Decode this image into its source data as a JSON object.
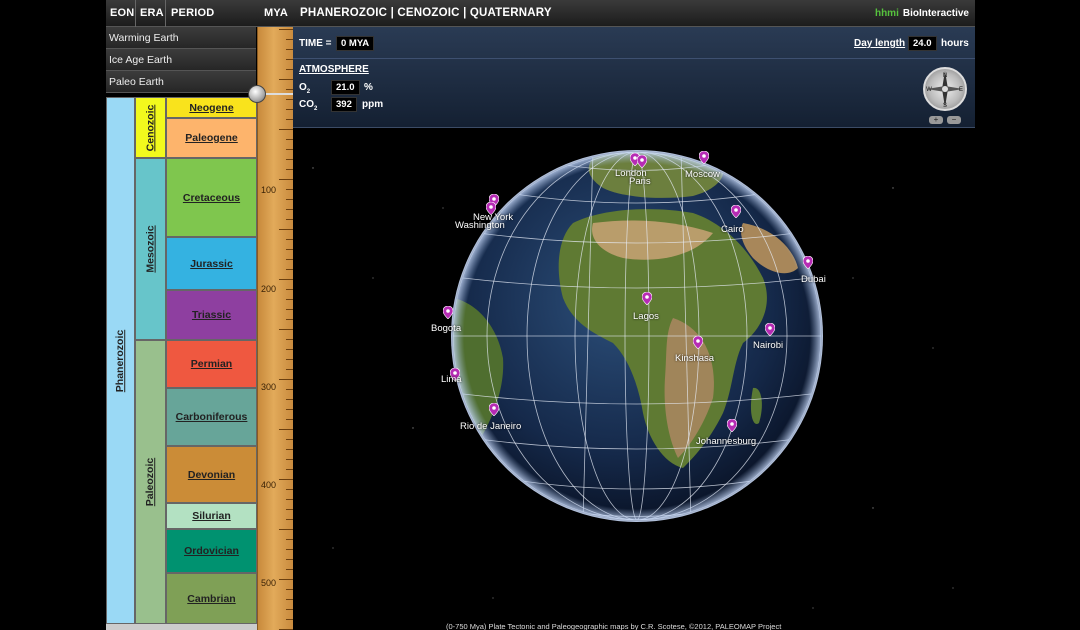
{
  "header": {
    "eon": "EON",
    "era": "ERA",
    "period": "PERIOD",
    "mya": "MYA",
    "breadcrumb": "PHANEROZOIC | CENOZOIC | QUATERNARY",
    "brand_hhmi": "hhmi",
    "brand_name": "BioInteractive"
  },
  "menu": [
    "Warming Earth",
    "Ice Age Earth",
    "Paleo Earth"
  ],
  "column": {
    "eon": "Phanerozoic",
    "eras": [
      "Cenozoic",
      "Mesozoic",
      "Paleozoic"
    ],
    "periods": [
      "Neogene",
      "Paleogene",
      "Cretaceous",
      "Jurassic",
      "Triassic",
      "Permian",
      "Carboniferous",
      "Devonian",
      "Silurian",
      "Ordovician",
      "Cambrian"
    ]
  },
  "ruler": {
    "labels": [
      "100",
      "200",
      "300",
      "400",
      "500"
    ]
  },
  "info": {
    "time_label": "TIME =",
    "time_value": "0 MYA",
    "day_label": "Day length",
    "day_value": "24.0",
    "day_unit": "hours",
    "atmosphere": "ATMOSPHERE",
    "o2_label": "O",
    "o2_sub": "2",
    "o2_value": "21.0",
    "o2_unit": "%",
    "co2_label": "CO",
    "co2_sub": "2",
    "co2_value": "392",
    "co2_unit": "ppm",
    "zoom_in": "+",
    "zoom_out": "−",
    "compass": {
      "n": "N",
      "s": "S",
      "e": "E",
      "w": "W"
    }
  },
  "cities": [
    "London",
    "Paris",
    "Moscow",
    "New York",
    "Washington",
    "Cairo",
    "Dubai",
    "Bogota",
    "Lagos",
    "Nairobi",
    "Kinshasa",
    "Lima",
    "Rio de Janeiro",
    "Johannesburg"
  ],
  "credit": "(0-750 Mya) Plate Tectonic and Paleogeographic maps by C.R. Scotese, ©2012, PALEOMAP Project",
  "colors": {
    "neogene": "#f9e31c",
    "paleogene": "#fdb46c",
    "cretaceous": "#7fc64e",
    "jurassic": "#34b2e1",
    "triassic": "#8e3fa0",
    "permian": "#ef5840",
    "carboniferous": "#67a599",
    "devonian": "#cb8c37",
    "silurian": "#b3e1c2",
    "ordovician": "#009270",
    "cambrian": "#7fa056",
    "cenozoic": "#f2f91d",
    "mesozoic": "#67c5ca",
    "paleozoic": "#99c08d",
    "phanerozoic": "#9ad9f5",
    "pin": "#b62bb4"
  }
}
